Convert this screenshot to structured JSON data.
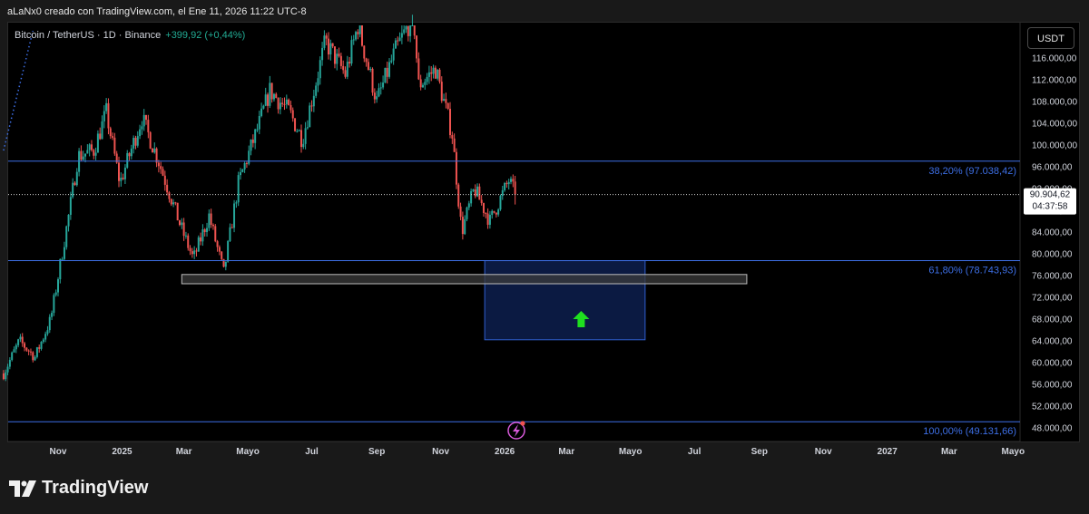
{
  "header": {
    "caption": "aLaNx0 creado con TradingView.com, el Ene 11, 2026 11:22 UTC-8"
  },
  "symbol": {
    "name": "Bitcoin / TetherUS · 1D · Binance",
    "change": "+399,92 (+0,44%)"
  },
  "currency_button": "USDT",
  "price_badge": {
    "price": "90.904,62",
    "timer": "04:37:58"
  },
  "footer": {
    "brand": "TradingView"
  },
  "colors": {
    "up": "#26a69a",
    "down": "#ef5350",
    "fib": "#3d6fe6",
    "zone_fill": "#0d1f4d",
    "arrow": "#1fe01f"
  },
  "chart_data": {
    "type": "candlestick",
    "ylim": [
      46000,
      122000
    ],
    "y_ticks": [
      {
        "value": 116000,
        "label": "116.000,00"
      },
      {
        "value": 112000,
        "label": "112.000,00"
      },
      {
        "value": 108000,
        "label": "108.000,00"
      },
      {
        "value": 104000,
        "label": "104.000,00"
      },
      {
        "value": 100000,
        "label": "100.000,00"
      },
      {
        "value": 96000,
        "label": "96.000,00"
      },
      {
        "value": 92000,
        "label": "92.000,00"
      },
      {
        "value": 88000,
        "label": "88.000,00"
      },
      {
        "value": 84000,
        "label": "84.000,00"
      },
      {
        "value": 80000,
        "label": "80.000,00"
      },
      {
        "value": 76000,
        "label": "76.000,00"
      },
      {
        "value": 72000,
        "label": "72.000,00"
      },
      {
        "value": 68000,
        "label": "68.000,00"
      },
      {
        "value": 64000,
        "label": "64.000,00"
      },
      {
        "value": 60000,
        "label": "60.000,00"
      },
      {
        "value": 56000,
        "label": "56.000,00"
      },
      {
        "value": 52000,
        "label": "52.000,00"
      },
      {
        "value": 48000,
        "label": "48.000,00"
      }
    ],
    "x_ticks": [
      {
        "date": "2024-11-01",
        "label": "Nov"
      },
      {
        "date": "2025-01-01",
        "label": "2025"
      },
      {
        "date": "2025-03-01",
        "label": "Mar"
      },
      {
        "date": "2025-05-01",
        "label": "Mayo"
      },
      {
        "date": "2025-07-01",
        "label": "Jul"
      },
      {
        "date": "2025-09-01",
        "label": "Sep"
      },
      {
        "date": "2025-11-01",
        "label": "Nov"
      },
      {
        "date": "2026-01-01",
        "label": "2026"
      },
      {
        "date": "2026-03-01",
        "label": "Mar"
      },
      {
        "date": "2026-05-01",
        "label": "Mayo"
      },
      {
        "date": "2026-07-01",
        "label": "Jul"
      },
      {
        "date": "2026-09-01",
        "label": "Sep"
      },
      {
        "date": "2026-11-01",
        "label": "Nov"
      },
      {
        "date": "2027-01-01",
        "label": "2027"
      },
      {
        "date": "2027-03-01",
        "label": "Mar"
      },
      {
        "date": "2027-05-01",
        "label": "Mayo"
      }
    ],
    "last_price": 90904.62,
    "fib_levels": [
      {
        "value": 97038.42,
        "label": "38,20% (97.038,42)"
      },
      {
        "value": 78743.93,
        "label": "61,80% (78.743,93)"
      },
      {
        "value": 49131.66,
        "label": "100,00% (49.131,66)"
      }
    ],
    "support_zone": {
      "date_start": "2025-02-27",
      "date_end": "2026-08-20",
      "low": 74500,
      "high": 76200
    },
    "target_zone": {
      "date_start": "2025-12-13",
      "date_end": "2026-05-15",
      "low": 64200,
      "high": 78743.93
    },
    "buy_arrow": {
      "date": "2026-03-15",
      "value": 68000
    },
    "trend_line": [
      {
        "date": "2024-09-10",
        "value": 99000
      },
      {
        "date": "2024-10-08",
        "value": 121000
      }
    ],
    "ohlc_anchors": [
      {
        "date": "2024-09-10",
        "close": 58000
      },
      {
        "date": "2024-09-25",
        "close": 64000
      },
      {
        "date": "2024-10-10",
        "close": 61000
      },
      {
        "date": "2024-10-25",
        "close": 68000
      },
      {
        "date": "2024-11-12",
        "close": 88000
      },
      {
        "date": "2024-11-20",
        "close": 98000
      },
      {
        "date": "2024-12-05",
        "close": 99000
      },
      {
        "date": "2024-12-17",
        "close": 106000
      },
      {
        "date": "2024-12-30",
        "close": 93000
      },
      {
        "date": "2025-01-20",
        "close": 105000
      },
      {
        "date": "2025-02-05",
        "close": 97000
      },
      {
        "date": "2025-02-26",
        "close": 85000
      },
      {
        "date": "2025-03-10",
        "close": 79000
      },
      {
        "date": "2025-03-25",
        "close": 87000
      },
      {
        "date": "2025-04-08",
        "close": 76500
      },
      {
        "date": "2025-04-22",
        "close": 93000
      },
      {
        "date": "2025-05-12",
        "close": 104000
      },
      {
        "date": "2025-05-22",
        "close": 110000
      },
      {
        "date": "2025-06-10",
        "close": 106000
      },
      {
        "date": "2025-06-22",
        "close": 101000
      },
      {
        "date": "2025-07-14",
        "close": 119000
      },
      {
        "date": "2025-08-02",
        "close": 113000
      },
      {
        "date": "2025-08-14",
        "close": 122000
      },
      {
        "date": "2025-09-01",
        "close": 108000
      },
      {
        "date": "2025-09-18",
        "close": 117000
      },
      {
        "date": "2025-10-06",
        "close": 124000
      },
      {
        "date": "2025-10-11",
        "close": 111000
      },
      {
        "date": "2025-10-27",
        "close": 114000
      },
      {
        "date": "2025-11-12",
        "close": 102000
      },
      {
        "date": "2025-11-21",
        "close": 84000
      },
      {
        "date": "2025-12-03",
        "close": 92000
      },
      {
        "date": "2025-12-18",
        "close": 86000
      },
      {
        "date": "2026-01-05",
        "close": 93500
      },
      {
        "date": "2026-01-11",
        "close": 90904.62
      }
    ]
  }
}
